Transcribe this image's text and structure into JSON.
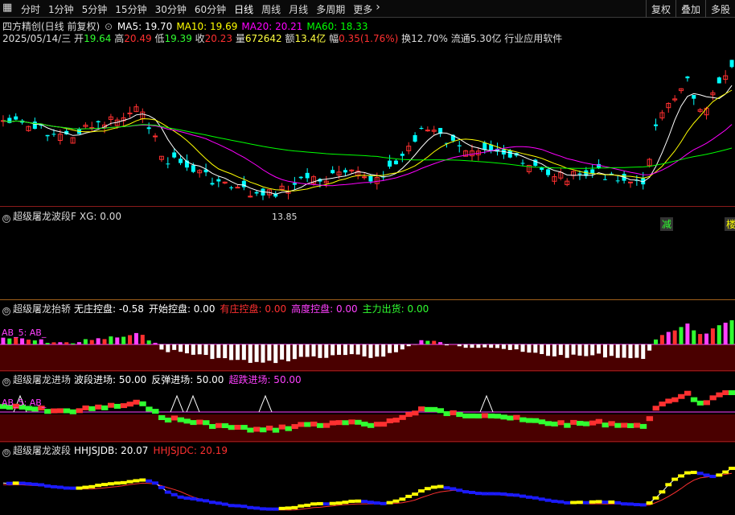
{
  "toolbar": {
    "menu_icon": "grid-icon",
    "tabs": [
      "分时",
      "1分钟",
      "5分钟",
      "15分钟",
      "30分钟",
      "60分钟",
      "日线",
      "周线",
      "月线",
      "多周期",
      "更多"
    ],
    "active": "日线",
    "right": [
      "复权",
      "叠加",
      "多股"
    ],
    "more_icon": "chevron-right-icon"
  },
  "main": {
    "stock": "四方精创(日线 前复权)",
    "ma": [
      {
        "label": "MA5: 19.70",
        "color": "#ffffff"
      },
      {
        "label": "MA10: 19.69",
        "color": "#ffff00"
      },
      {
        "label": "MA20: 20.21",
        "color": "#ff00ff"
      },
      {
        "label": "MA60: 18.33",
        "color": "#00ff00"
      }
    ],
    "info": {
      "date": "2025/05/14/三",
      "open_l": "开",
      "open": "19.64",
      "high_l": "高",
      "high": "20.49",
      "low_l": "低",
      "low": "19.39",
      "close_l": "收",
      "close": "20.23",
      "vol_l": "量",
      "vol": "672642",
      "amt_l": "额",
      "amt": "13.4亿",
      "chg_l": "幅",
      "chg": "0.35(1.76%)",
      "turn": "换12.70%",
      "float": "流通5.30亿",
      "industry": "行业应用软件"
    },
    "low_label": "13.85",
    "tag1": "减",
    "tag2": "楼"
  },
  "panels": [
    {
      "name": "超级屠龙波段F",
      "items": [
        {
          "t": "XG: 0.00",
          "c": "#dddddd"
        }
      ]
    },
    {
      "name": "超级屠龙抬轿",
      "items": [
        {
          "t": "无庄控盘: -0.58",
          "c": "#ffffff"
        },
        {
          "t": "开始控盘: 0.00",
          "c": "#ffffff"
        },
        {
          "t": "有庄控盘: 0.00",
          "c": "#ff3030"
        },
        {
          "t": "高度控盘: 0.00",
          "c": "#ff40ff"
        },
        {
          "t": "主力出货: 0.00",
          "c": "#30ff30"
        }
      ],
      "axis": "AB_5: AB_"
    },
    {
      "name": "超级屠龙进场",
      "items": [
        {
          "t": "波段进场: 50.00",
          "c": "#ffffff"
        },
        {
          "t": "反弹进场: 50.00",
          "c": "#ffffff"
        },
        {
          "t": "超跌进场: 50.00",
          "c": "#ff40ff"
        }
      ],
      "axis": "AB_5: AB_"
    },
    {
      "name": "超级屠龙波段",
      "items": [
        {
          "t": "HHJSJDB: 20.07",
          "c": "#ffffff"
        },
        {
          "t": "HHJSJDC: 20.19",
          "c": "#ff3030"
        }
      ]
    }
  ],
  "colors": {
    "up": "#ff3030",
    "down": "#00ffff",
    "ma5": "#ffffff",
    "ma10": "#ffff00",
    "ma20": "#ff00ff",
    "ma60": "#00ff00"
  }
}
